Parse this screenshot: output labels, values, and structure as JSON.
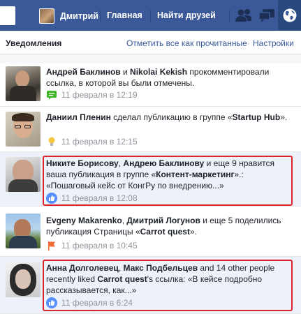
{
  "topbar": {
    "user_name": "Дмитрий",
    "home": "Главная",
    "find_friends": "Найти друзей",
    "icons": [
      "friend-requests-icon",
      "messages-icon",
      "notifications-globe-icon"
    ],
    "color": "#3b5998"
  },
  "panel": {
    "title": "Уведомления",
    "mark_all_read": "Отметить все как прочитанные",
    "separator": "·",
    "settings": "Настройки"
  },
  "notifications": [
    {
      "parts": [
        {
          "b": "Андрей Баклинов"
        },
        {
          "t": " и "
        },
        {
          "b": "Nikolai Kekish"
        },
        {
          "t": " прокомментировали ссылка, в которой вы были отмечены."
        }
      ],
      "time": "11 февраля в 12:19",
      "type_icon": "comment-icon",
      "highlighted": false
    },
    {
      "parts": [
        {
          "b": "Даниил Пленин"
        },
        {
          "t": " сделал публикацию в группе «"
        },
        {
          "b": "Startup Hub"
        },
        {
          "t": "»."
        }
      ],
      "time": "11 февраля в 12:15",
      "type_icon": "lightbulb-icon",
      "highlighted": false
    },
    {
      "parts": [
        {
          "b": "Никите Борисову"
        },
        {
          "t": ", "
        },
        {
          "b": "Андрею Баклинову"
        },
        {
          "t": " и еще 9 нравится ваша публикация в группе «"
        },
        {
          "b": "Контент-маркетинг"
        },
        {
          "t": "».: «Пошаговый кейс от КонгРу по внедрению...»"
        }
      ],
      "time": "11 февраля в 12:08",
      "type_icon": "like-icon",
      "highlighted": true
    },
    {
      "parts": [
        {
          "b": "Evgeny Makarenko"
        },
        {
          "t": ", "
        },
        {
          "b": "Дмитрий Логунов"
        },
        {
          "t": " и еще 5 поделились публикация Страницы «"
        },
        {
          "b": "Carrot quest"
        },
        {
          "t": "»."
        }
      ],
      "time": "11 февраля в 10:45",
      "type_icon": "page-flag-icon",
      "highlighted": false
    },
    {
      "parts": [
        {
          "b": "Анна Долголевец"
        },
        {
          "t": ", "
        },
        {
          "b": "Макс Подбельцев"
        },
        {
          "t": " and 14 other people recently liked "
        },
        {
          "b": "Carrot quest"
        },
        {
          "t": "'s ссылка: «В кейсе подробно рассказывается, как...»"
        }
      ],
      "time": "11 февраля в 6:24",
      "type_icon": "like-icon",
      "highlighted": true
    }
  ],
  "colors": {
    "link": "#365899",
    "highlight_border": "#d9262c",
    "unread_bg": "#edf2fa",
    "meta": "#90949c"
  }
}
